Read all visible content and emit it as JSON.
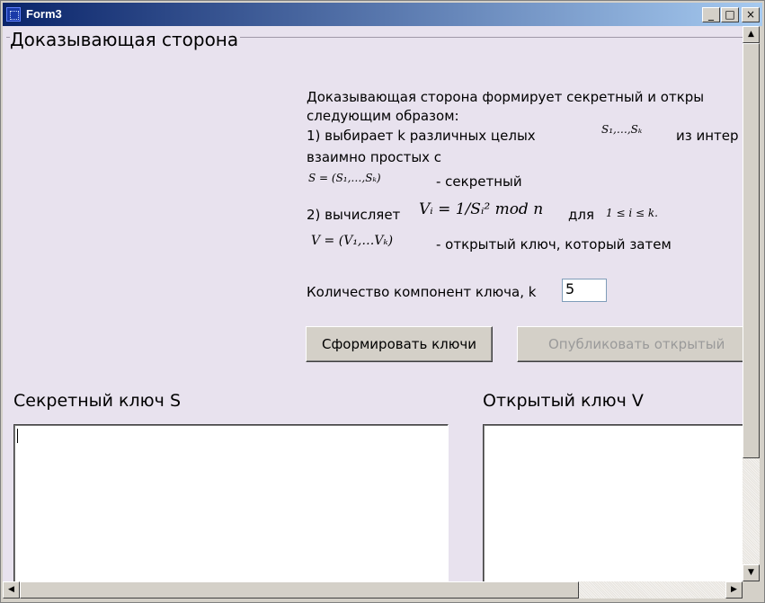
{
  "window": {
    "title": "Form3",
    "minimize": "_",
    "maximize": "□",
    "close": "×"
  },
  "group": {
    "title": "Доказывающая сторона"
  },
  "description": {
    "line1": "Доказывающая сторона формирует секретный и откры",
    "line2": "следующим образом:",
    "line3a": "1) выбирает k различных целых",
    "line3_math": "S₁,…,Sₖ",
    "line3b": "из интер",
    "line4": "взаимно простых с",
    "secret_math": "S = (S₁,…,Sₖ)",
    "secret_label": "- секретный",
    "step2a": "2) вычисляет",
    "step2_math": "Vᵢ = 1/Sᵢ² mod n",
    "step2b": "для",
    "step2_cond": "1 ≤ i ≤ k.",
    "public_math": "V = (V₁,…Vₖ)",
    "public_label": "- открытый ключ, который затем"
  },
  "key_count": {
    "label": "Количество компонент ключа, k",
    "value": "5"
  },
  "buttons": {
    "generate": "Сформировать ключи",
    "publish": "Опубликовать открытый"
  },
  "secret_key": {
    "header": "Секретный ключ S",
    "value": ""
  },
  "public_key": {
    "header": "Открытый ключ V",
    "value": ""
  },
  "scrollbar": {
    "up": "▲",
    "down": "▼",
    "left": "◀",
    "right": "▶"
  }
}
